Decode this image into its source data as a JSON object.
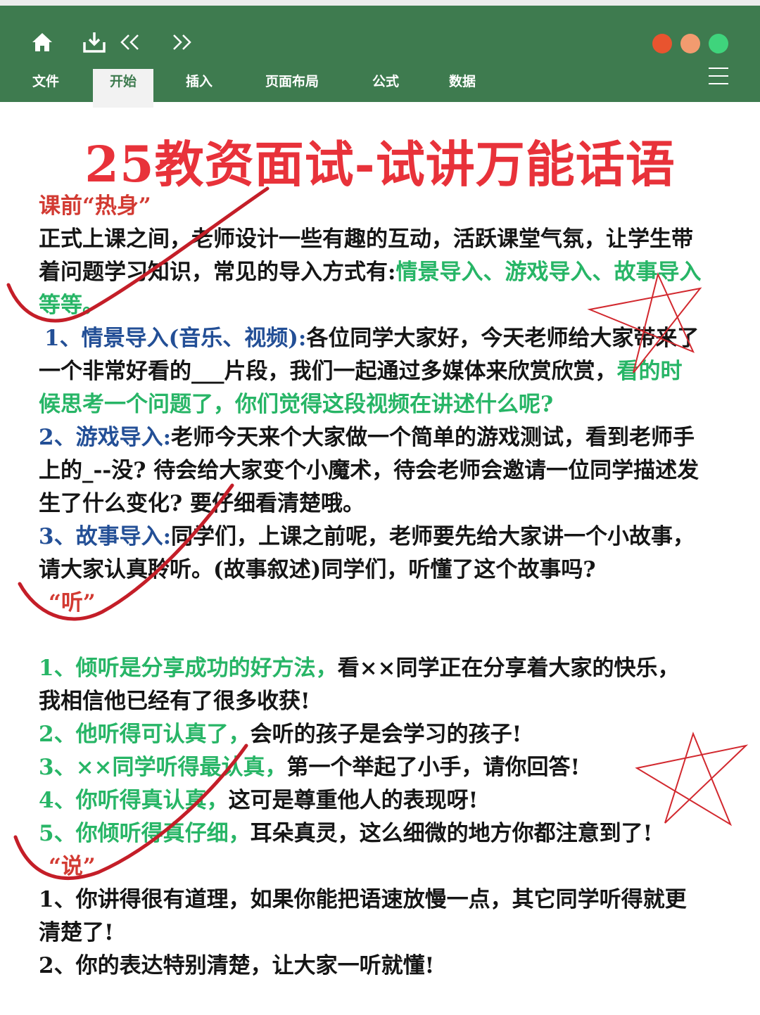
{
  "toolbar": {
    "home_icon": "home-icon",
    "download_icon": "download-icon",
    "back_icon": "double-chevron-left-icon",
    "forward_icon": "double-chevron-right-icon",
    "window_dots": [
      "#e8542f",
      "#f29b6f",
      "#3fd47c"
    ]
  },
  "tabs": [
    "文件",
    "开始",
    "插入",
    "页面布局",
    "公式",
    "数据"
  ],
  "active_tab": "开始",
  "colors": {
    "ribbon": "#3e7b4f",
    "title": "#e8323a",
    "heading": "#d23a32",
    "highlight_green": "#27b566",
    "highlight_blue": "#234f96"
  },
  "document": {
    "title": "25教资面试-试讲万能话语",
    "section1": {
      "heading": "课前“热身”",
      "intro_line1": "正式上课之间，老师设计一些有趣的互动，活跃课堂气氛，让学生带",
      "intro_line2_a": "着问题学习知识，常见的导入方式有:",
      "intro_line2_b": "情景导入、游戏导入、故事导入",
      "intro_line3": "等等。",
      "item1_label": "1、情景导入(音乐、视频):",
      "item1_text_a": "各位同学大家好，今天老师给大家带来了",
      "item1_text_b": "一个非常好看的___片段，我们一起通过多媒体来欣赏欣赏，",
      "item1_text_c": "看的时",
      "item1_text_d": "候思考一个问题了，你们觉得这段视频在讲述什么呢?",
      "item2_label": "2、游戏导入:",
      "item2_text_a": "老师今天来个大家做一个简单的游戏测试，看到老师手",
      "item2_text_b": "上的_--没? 待会给大家变个小魔术，待会老师会邀请一位同学描述发",
      "item2_text_c": "生了什么变化? 要仔细看清楚哦。",
      "item3_label": "3、故事导入:",
      "item3_text_a": "同学们，上课之前呢，老师要先给大家讲一个小故事，",
      "item3_text_b": "请大家认真聆听。(故事叙述)同学们，听懂了这个故事吗?"
    },
    "section2": {
      "heading": "“听”",
      "item1_green": "1、倾听是分享成功的好方法，",
      "item1_text": "看××同学正在分享着大家的快乐，",
      "item1_text_b": "我相信他已经有了很多收获!",
      "item2_green": "2、他听得可认真了，",
      "item2_text": "会听的孩子是会学习的孩子!",
      "item3_green": "3、××同学听得最认真，",
      "item3_text": "第一个举起了小手，请你回答!",
      "item4_green": "4、你听得真认真，",
      "item4_text": "这可是尊重他人的表现呀!",
      "item5_green": "5、你倾听得真仔细，",
      "item5_text": "耳朵真灵，这么细微的地方你都注意到了!"
    },
    "section3": {
      "heading": "“说”",
      "item1_a": "1、你讲得很有道理，如果你能把语速放慢一点，其它同学听得就更",
      "item1_b": "清楚了!",
      "item2": "2、你的表达特别清楚，让大家一听就懂!"
    }
  }
}
